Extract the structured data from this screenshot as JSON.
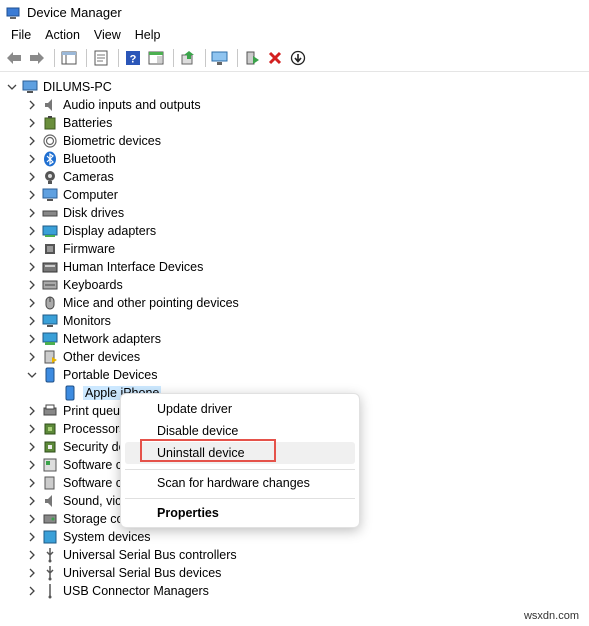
{
  "window": {
    "title": "Device Manager"
  },
  "menu": [
    "File",
    "Action",
    "View",
    "Help"
  ],
  "toolbar": {
    "buttons": [
      "back-icon",
      "forward-icon",
      "properties-sheet-icon",
      "show-hide-tree-icon",
      "help-icon",
      "view-icon",
      "update-driver-icon",
      "scan-hardware-icon",
      "add-legacy-icon",
      "uninstall-icon",
      "disable-icon"
    ]
  },
  "tree": {
    "root": "DILUMS-PC",
    "categories": [
      "Audio inputs and outputs",
      "Batteries",
      "Biometric devices",
      "Bluetooth",
      "Cameras",
      "Computer",
      "Disk drives",
      "Display adapters",
      "Firmware",
      "Human Interface Devices",
      "Keyboards",
      "Mice and other pointing devices",
      "Monitors",
      "Network adapters",
      "Other devices",
      "Portable Devices"
    ],
    "expanded_child": "Apple iPhone",
    "categories_after": [
      "Print queues",
      "Processors",
      "Security devices",
      "Software components",
      "Software devices",
      "Sound, video and game controllers",
      "Storage controllers",
      "System devices",
      "Universal Serial Bus controllers",
      "Universal Serial Bus devices",
      "USB Connector Managers"
    ],
    "visible_after": [
      "Print queu",
      "Processors",
      "Security de",
      "Software c",
      "Software c",
      "Sound, vic",
      "Storage co",
      "System devices",
      "Universal Serial Bus controllers",
      "Universal Serial Bus devices",
      "USB Connector Managers"
    ]
  },
  "context_menu": {
    "items": {
      "update": "Update driver",
      "disable": "Disable device",
      "uninstall": "Uninstall device",
      "scan": "Scan for hardware changes",
      "properties": "Properties"
    }
  },
  "watermark": "wsxdn.com"
}
